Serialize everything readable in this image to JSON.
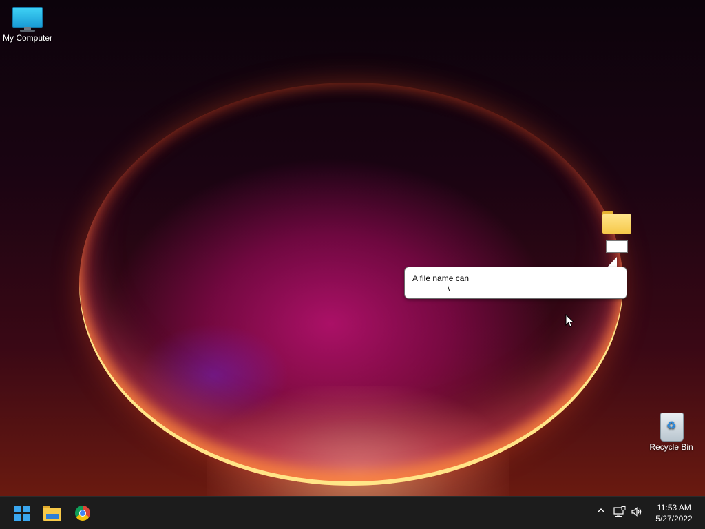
{
  "desktop": {
    "icons": [
      {
        "label": "My Computer",
        "icon": "monitor-icon"
      },
      {
        "label": "",
        "icon": "folder-icon",
        "renaming": true
      },
      {
        "label": "Recycle Bin",
        "icon": "recycle-bin-icon"
      }
    ],
    "tooltip": {
      "line1": "A file name can",
      "line2": "\\"
    }
  },
  "taskbar": {
    "pinned": [
      {
        "name": "Start",
        "icon": "windows-logo-icon"
      },
      {
        "name": "File Explorer",
        "icon": "file-explorer-icon"
      },
      {
        "name": "Google Chrome",
        "icon": "chrome-icon"
      }
    ],
    "tray": {
      "chevron": "^",
      "network_icon": "network-icon",
      "volume_icon": "volume-icon"
    },
    "clock": {
      "time": "11:53 AM",
      "date": "5/27/2022"
    }
  },
  "colors": {
    "taskbar_bg": "#1c1c1c",
    "windows_accent": "#3aa7f0",
    "folder_yellow": "#f6c94a"
  }
}
